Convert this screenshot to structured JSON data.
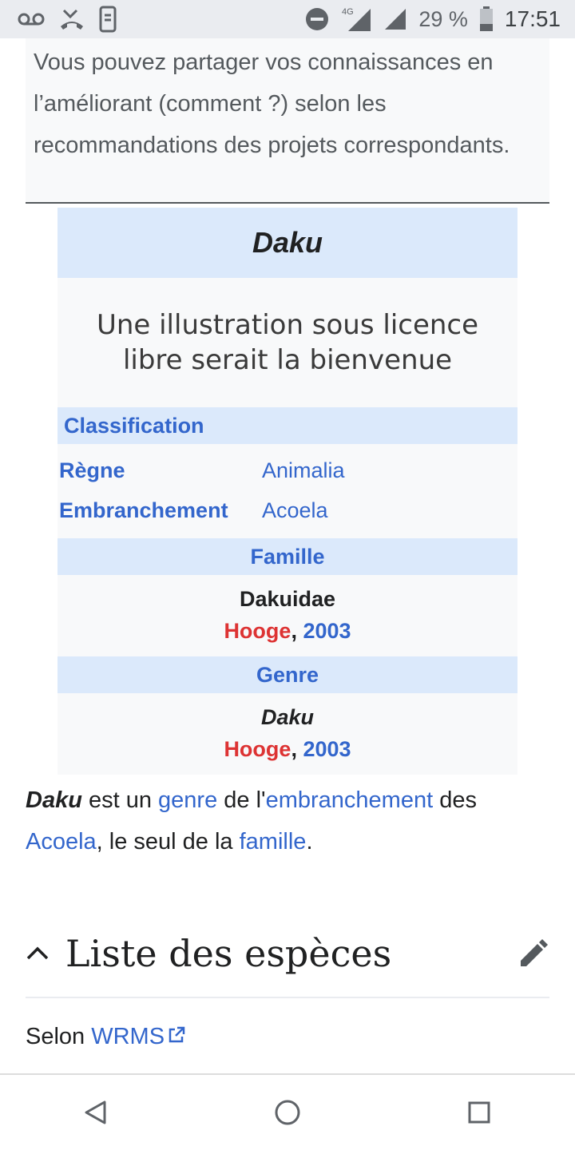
{
  "status_bar": {
    "network": "4G",
    "battery": "29 %",
    "time": "17:51"
  },
  "notice": {
    "text": "Vous pouvez partager vos connaissances en l’améliorant (comment ?) selon les recommandations des projets correspondants."
  },
  "infobox": {
    "title": "Daku",
    "image_placeholder_line1": "Une illustration sous licence",
    "image_placeholder_line2": "libre serait la bienvenue",
    "classification_header": "Classification",
    "rows": [
      {
        "label": "Règne",
        "value": "Animalia"
      },
      {
        "label": "Embranchement",
        "value": "Acoela"
      }
    ],
    "family_header": "Famille",
    "family_name": "Dakuidae",
    "family_author": "Hooge",
    "family_sep": ",",
    "family_year": "2003",
    "genus_header": "Genre",
    "genus_name": "Daku",
    "genus_author": "Hooge",
    "genus_sep": ",",
    "genus_year": "2003"
  },
  "paragraph": {
    "b1": "Daku",
    "t1": " est un ",
    "l1": "genre",
    "t2": " de l'",
    "l2": "embranchement",
    "t3": " des ",
    "l3": "Acoela",
    "t4": ", le seul de la ",
    "l4": "famille",
    "t5": "."
  },
  "section": {
    "title": "Liste des espèces"
  },
  "source": {
    "prefix": "Selon ",
    "link": "WRMS"
  },
  "colors": {
    "link": "#3366cc",
    "redlink": "#dd3333",
    "infobox_header": "#dbe9fb",
    "statusbar": "#eaecf0"
  },
  "icons": [
    "voicemail-icon",
    "missed-call-icon",
    "phone-vibrate-icon",
    "do-not-disturb-icon",
    "signal-4g-icon",
    "signal-icon",
    "battery-icon",
    "chevron-up-icon",
    "pencil-icon",
    "external-link-icon",
    "back-icon",
    "home-icon",
    "recents-icon"
  ]
}
